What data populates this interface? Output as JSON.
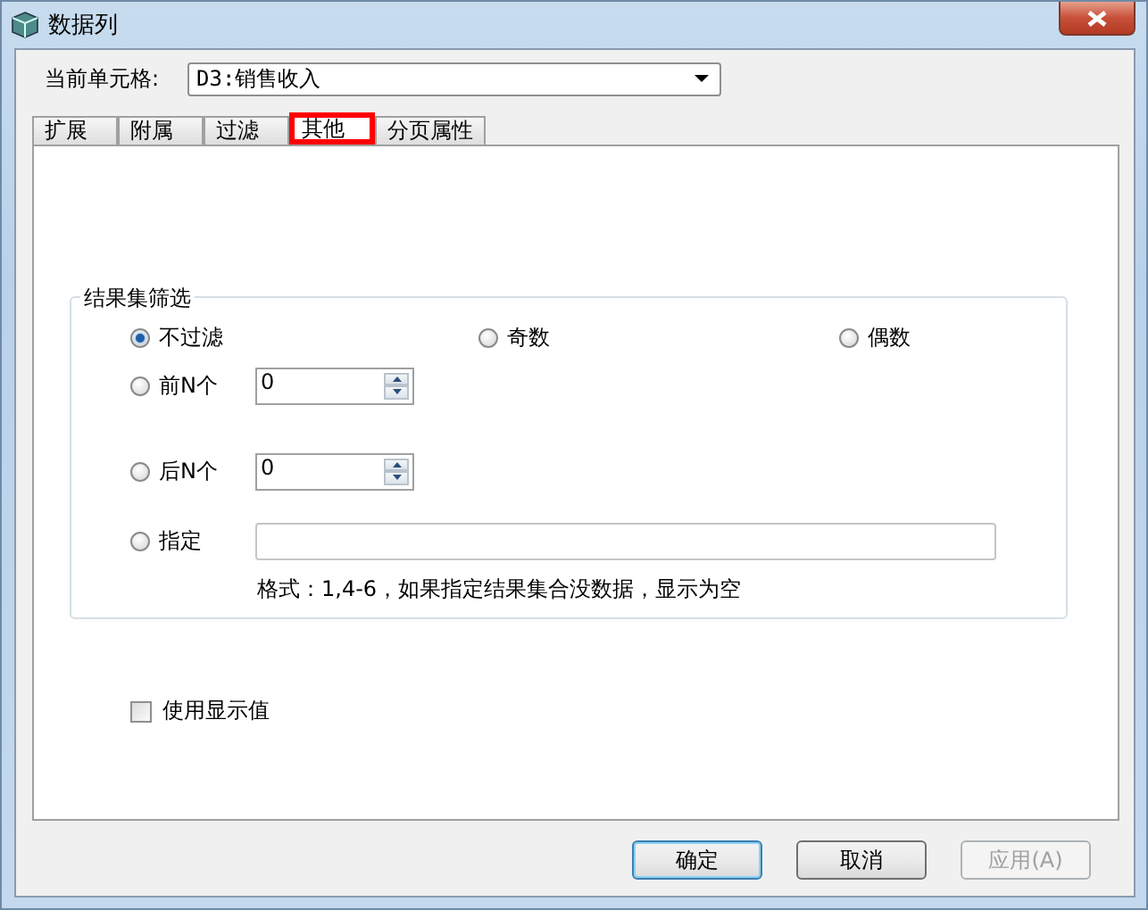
{
  "window": {
    "title": "数据列"
  },
  "current_cell": {
    "label": "当前单元格:",
    "value": "D3:销售收入"
  },
  "tabs": [
    {
      "label": "扩展",
      "selected": false,
      "highlighted": false
    },
    {
      "label": "附属",
      "selected": false,
      "highlighted": false
    },
    {
      "label": "过滤",
      "selected": false,
      "highlighted": false
    },
    {
      "label": "其他",
      "selected": true,
      "highlighted": true
    },
    {
      "label": "分页属性",
      "selected": false,
      "highlighted": false
    }
  ],
  "result_filter": {
    "title": "结果集筛选",
    "options": [
      {
        "kind": "plain",
        "label": "不过滤",
        "selected": true
      },
      {
        "kind": "plain",
        "label": "奇数",
        "selected": false
      },
      {
        "kind": "plain",
        "label": "偶数",
        "selected": false
      },
      {
        "kind": "spin",
        "label": "前N个",
        "selected": false,
        "value": "0"
      },
      {
        "kind": "spin",
        "label": "后N个",
        "selected": false,
        "value": "0"
      },
      {
        "kind": "text",
        "label": "指定",
        "selected": false
      }
    ],
    "hint": "格式：1,4-6，如果指定结果集合没数据，显示为空"
  },
  "use_display_value": {
    "label": "使用显示值",
    "checked": false
  },
  "buttons": [
    {
      "label": "确定",
      "default": true,
      "disabled": false
    },
    {
      "label": "取消",
      "default": false,
      "disabled": false
    },
    {
      "label": "应用(A)",
      "default": false,
      "disabled": true
    }
  ]
}
